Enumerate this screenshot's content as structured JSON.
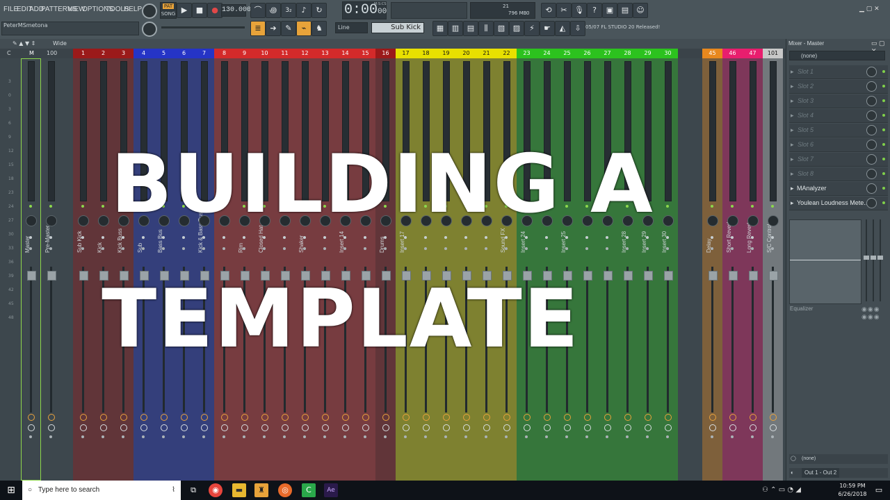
{
  "menu": [
    "FILE",
    "EDIT",
    "ADD",
    "PATTERNS",
    "VIEW",
    "OPTIONS",
    "TOOLS",
    "HELP"
  ],
  "transport": {
    "pat_label": "PAT",
    "song_label": "SONG",
    "tempo": "130.000",
    "time": "0:00",
    "time_fraction": "00",
    "time_unit": "M:S:CS"
  },
  "cpu": {
    "value1": "21",
    "memory": "796 MB",
    "value2": "0"
  },
  "hint_user": "PeterMSmetona",
  "toolbar2": {
    "line_mode": "Line",
    "instrument": "Sub Kick",
    "news": "05/07  FL STUDIO 20 Released!"
  },
  "mixer_toolbar": {
    "view_label": "Wide"
  },
  "mixer_title": "Mixer - Master",
  "header_cells": [
    "C",
    "M",
    "100"
  ],
  "db_scale": [
    "3",
    "0",
    "3",
    "6",
    "9",
    "12",
    "15",
    "18",
    "23",
    "24",
    "27",
    "30",
    "33",
    "36",
    "39",
    "42",
    "45",
    "48"
  ],
  "tracks": [
    {
      "num": "",
      "name": "Master",
      "color": "#3d474d"
    },
    {
      "num": "",
      "name": "Pre-Master",
      "color": "#3d474d"
    },
    {
      "num": "1",
      "name": "Sub Kick",
      "color": "#9b1a1a"
    },
    {
      "num": "2",
      "name": "Kick",
      "color": "#9b1a1a"
    },
    {
      "num": "3",
      "name": "Kick Buss",
      "color": "#9b1a1a"
    },
    {
      "num": "4",
      "name": "Sub",
      "color": "#2534c6"
    },
    {
      "num": "5",
      "name": "Bass Bus",
      "color": "#2534c6"
    },
    {
      "num": "6",
      "name": "",
      "color": "#2534c6"
    },
    {
      "num": "7",
      "name": "Kick & Bass Buss",
      "color": "#2534c6"
    },
    {
      "num": "8",
      "name": "",
      "color": "#d42a2a"
    },
    {
      "num": "9",
      "name": "Rim",
      "color": "#d42a2a"
    },
    {
      "num": "10",
      "name": "Closed Hat",
      "color": "#d42a2a"
    },
    {
      "num": "11",
      "name": "",
      "color": "#d42a2a"
    },
    {
      "num": "12",
      "name": "Shaker",
      "color": "#d42a2a"
    },
    {
      "num": "13",
      "name": "",
      "color": "#d42a2a"
    },
    {
      "num": "14",
      "name": "Insert 14",
      "color": "#d42a2a"
    },
    {
      "num": "15",
      "name": "",
      "color": "#d42a2a"
    },
    {
      "num": "16",
      "name": "Drums",
      "color": "#9b1a1a"
    },
    {
      "num": "17",
      "name": "Insert 17",
      "color": "#e8e000"
    },
    {
      "num": "18",
      "name": "",
      "color": "#e8e000"
    },
    {
      "num": "19",
      "name": "",
      "color": "#e8e000"
    },
    {
      "num": "20",
      "name": "",
      "color": "#e8e000"
    },
    {
      "num": "21",
      "name": "",
      "color": "#e8e000"
    },
    {
      "num": "22",
      "name": "Sound FX",
      "color": "#e8e000"
    },
    {
      "num": "23",
      "name": "Insert 24",
      "color": "#2cc21e"
    },
    {
      "num": "24",
      "name": "",
      "color": "#2cc21e"
    },
    {
      "num": "25",
      "name": "Insert 25",
      "color": "#2cc21e"
    },
    {
      "num": "26",
      "name": "",
      "color": "#2cc21e"
    },
    {
      "num": "27",
      "name": "",
      "color": "#2cc21e"
    },
    {
      "num": "28",
      "name": "Insert 28",
      "color": "#2cc21e"
    },
    {
      "num": "29",
      "name": "Insert 29",
      "color": "#2cc21e"
    },
    {
      "num": "30",
      "name": "Insert 30",
      "color": "#2cc21e"
    },
    {
      "num": "45",
      "name": "Delay",
      "color": "#e8881e"
    },
    {
      "num": "46",
      "name": "Short Reverb",
      "color": "#e81e6e"
    },
    {
      "num": "47",
      "name": "Long Reverb",
      "color": "#e81e6e"
    },
    {
      "num": "101",
      "name": "S/C Control",
      "color": "#c8c8c8"
    }
  ],
  "right_panel": {
    "input": "(none)",
    "slots": [
      "Slot 1",
      "Slot 2",
      "Slot 3",
      "Slot 4",
      "Slot 5",
      "Slot 6",
      "Slot 7",
      "Slot 8"
    ],
    "plugins": [
      "MAnalyzer",
      "Youlean Loudness Mete..."
    ],
    "equalizer_label": "Equalizer",
    "output_none": "(none)",
    "output": "Out 1 - Out 2"
  },
  "overlay": {
    "line1": "BUILDING A",
    "line2": "TEMPLATE"
  },
  "taskbar": {
    "search_placeholder": "Type here to search",
    "time": "10:59 PM",
    "date": "6/26/2018"
  }
}
